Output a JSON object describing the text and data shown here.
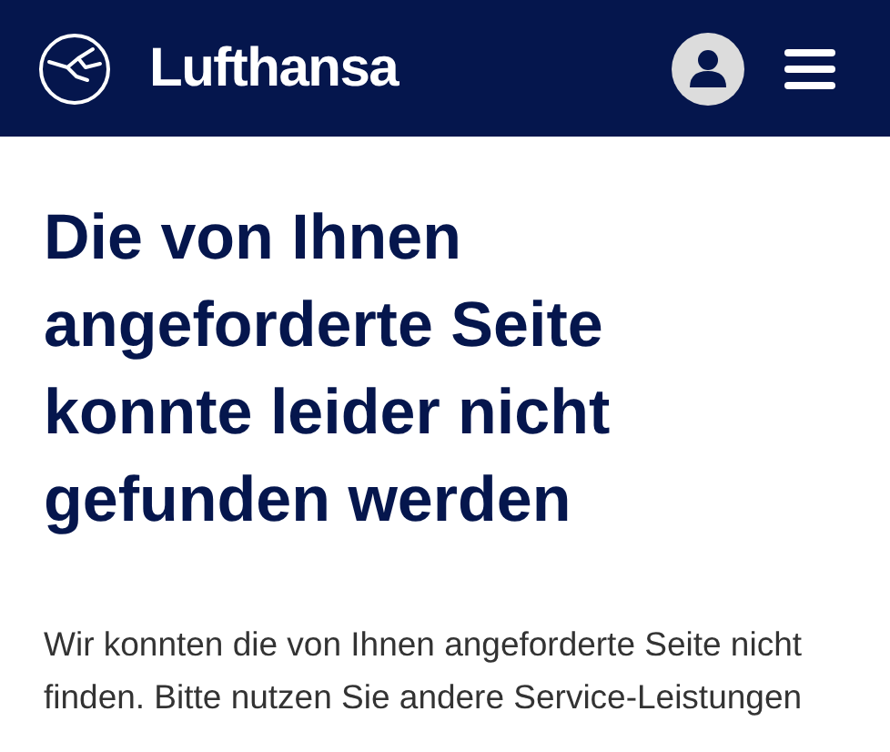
{
  "header": {
    "brand": "Lufthansa"
  },
  "heading": "Die von Ihnen angeforderte Seite konnte leider nicht gefunden werden",
  "message": "Wir konnten die von Ihnen angeforderte Seite nicht finden. Bitte nutzen Sie andere Service-Leistungen"
}
